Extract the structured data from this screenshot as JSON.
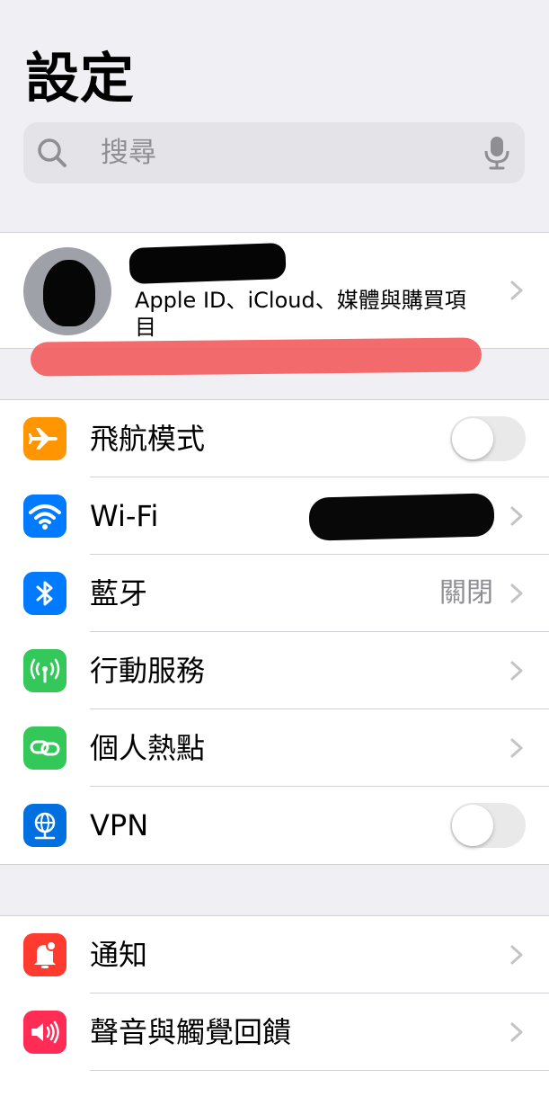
{
  "header": {
    "title": "設定"
  },
  "search": {
    "placeholder": "搜尋"
  },
  "profile": {
    "subtitle": "Apple ID、iCloud、媒體與購買項目"
  },
  "connectivity": [
    {
      "id": "airplane",
      "label": "飛航模式",
      "icon": "airplane-icon",
      "color": "#ff9500",
      "control": "toggle",
      "on": false
    },
    {
      "id": "wifi",
      "label": "Wi-Fi",
      "icon": "wifi-icon",
      "color": "#007aff",
      "control": "chevron"
    },
    {
      "id": "bluetooth",
      "label": "藍牙",
      "icon": "bluetooth-icon",
      "color": "#007aff",
      "value": "關閉",
      "control": "chevron"
    },
    {
      "id": "cellular",
      "label": "行動服務",
      "icon": "antenna-icon",
      "color": "#34c759",
      "control": "chevron"
    },
    {
      "id": "hotspot",
      "label": "個人熱點",
      "icon": "link-icon",
      "color": "#34c759",
      "control": "chevron"
    },
    {
      "id": "vpn",
      "label": "VPN",
      "icon": "globe-icon",
      "color": "#006fe0",
      "control": "toggle",
      "on": false
    }
  ],
  "general": [
    {
      "id": "notifications",
      "label": "通知",
      "icon": "bell-icon",
      "color": "#ff3b30",
      "control": "chevron"
    },
    {
      "id": "sounds",
      "label": "聲音與觸覺回饋",
      "icon": "speaker-icon",
      "color": "#ff2d55",
      "control": "chevron"
    }
  ]
}
